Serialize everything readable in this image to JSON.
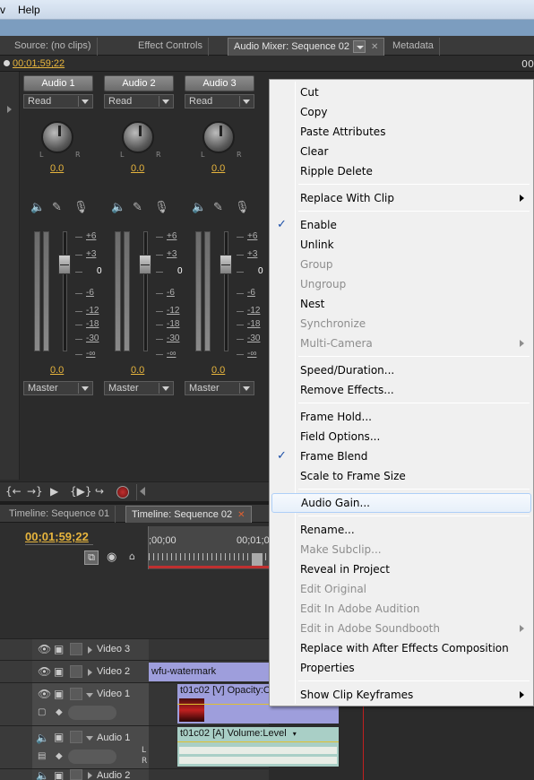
{
  "menubar": {
    "items": [
      "v",
      "Help"
    ]
  },
  "panel_tabs": [
    {
      "label": "Source: (no clips)",
      "active": false
    },
    {
      "label": "Effect Controls",
      "active": false
    },
    {
      "label": "Audio Mixer: Sequence 02",
      "active": true
    },
    {
      "label": "Metadata",
      "active": false
    }
  ],
  "timecode": {
    "left": "00;01;59;22",
    "right": "00;"
  },
  "mixer": {
    "channels": [
      {
        "name": "Audio 1",
        "mode": "Read",
        "pan": "0.0",
        "volume": "0.0",
        "output": "Master"
      },
      {
        "name": "Audio 2",
        "mode": "Read",
        "pan": "0.0",
        "volume": "0.0",
        "output": "Master"
      },
      {
        "name": "Audio 3",
        "mode": "Read",
        "pan": "0.0",
        "volume": "0.0",
        "output": "Master"
      }
    ],
    "pan_left": "L",
    "pan_right": "R",
    "scale": [
      "+6",
      "+3",
      "0",
      "-6",
      "-12",
      "-18",
      "-30",
      "-∞"
    ]
  },
  "transport": {
    "buttons": [
      "{←",
      "→}",
      "▶",
      "{▶}",
      "↪",
      "record"
    ]
  },
  "timeline": {
    "tabs": [
      {
        "label": "Timeline: Sequence 01",
        "active": false
      },
      {
        "label": "Timeline: Sequence 02",
        "active": true
      }
    ],
    "timecode": "00;01;59;22",
    "ruler": {
      "start": ";00;00",
      "next": "00;01;0"
    },
    "tracks": [
      {
        "name": "Video 3",
        "clip": ""
      },
      {
        "name": "Video 2",
        "clip": "wfu-watermark"
      },
      {
        "name": "Video 1",
        "clip": "t01c02 [V]  Opacity:O"
      },
      {
        "name": "Audio 1",
        "clip": "t01c02 [A]  Volume:Level",
        "lr": [
          "L",
          "R"
        ]
      },
      {
        "name": "Audio 2",
        "clip": ""
      }
    ]
  },
  "context_menu": {
    "groups": [
      [
        {
          "label": "Cut",
          "enabled": true
        },
        {
          "label": "Copy",
          "enabled": true
        },
        {
          "label": "Paste Attributes",
          "enabled": true
        },
        {
          "label": "Clear",
          "enabled": true
        },
        {
          "label": "Ripple Delete",
          "enabled": true
        }
      ],
      [
        {
          "label": "Replace With Clip",
          "enabled": true,
          "submenu": true
        }
      ],
      [
        {
          "label": "Enable",
          "enabled": true,
          "checked": true
        },
        {
          "label": "Unlink",
          "enabled": true
        },
        {
          "label": "Group",
          "enabled": false
        },
        {
          "label": "Ungroup",
          "enabled": false
        },
        {
          "label": "Nest",
          "enabled": true
        },
        {
          "label": "Synchronize",
          "enabled": false
        },
        {
          "label": "Multi-Camera",
          "enabled": false,
          "submenu": true
        }
      ],
      [
        {
          "label": "Speed/Duration...",
          "enabled": true
        },
        {
          "label": "Remove Effects...",
          "enabled": true
        }
      ],
      [
        {
          "label": "Frame Hold...",
          "enabled": true
        },
        {
          "label": "Field Options...",
          "enabled": true
        },
        {
          "label": "Frame Blend",
          "enabled": true,
          "checked": true
        },
        {
          "label": "Scale to Frame Size",
          "enabled": true
        }
      ],
      [
        {
          "label": "Audio Gain...",
          "enabled": true,
          "highlighted": true
        }
      ],
      [
        {
          "label": "Rename...",
          "enabled": true
        },
        {
          "label": "Make Subclip...",
          "enabled": false
        },
        {
          "label": "Reveal in Project",
          "enabled": true
        },
        {
          "label": "Edit Original",
          "enabled": false
        },
        {
          "label": "Edit In Adobe Audition",
          "enabled": false
        },
        {
          "label": "Edit in Adobe Soundbooth",
          "enabled": false,
          "submenu": true
        },
        {
          "label": "Replace with After Effects Composition",
          "enabled": true
        },
        {
          "label": "Properties",
          "enabled": true
        }
      ],
      [
        {
          "label": "Show Clip Keyframes",
          "enabled": true,
          "submenu": true
        }
      ]
    ]
  },
  "colors": {
    "timecode": "#e7b53d",
    "menu_bg": "#f0f0f0",
    "highlight_border": "#aecff7",
    "playhead": "#c03030",
    "clip_video": "#9e9edc",
    "clip_audio": "#a9cfc6"
  }
}
